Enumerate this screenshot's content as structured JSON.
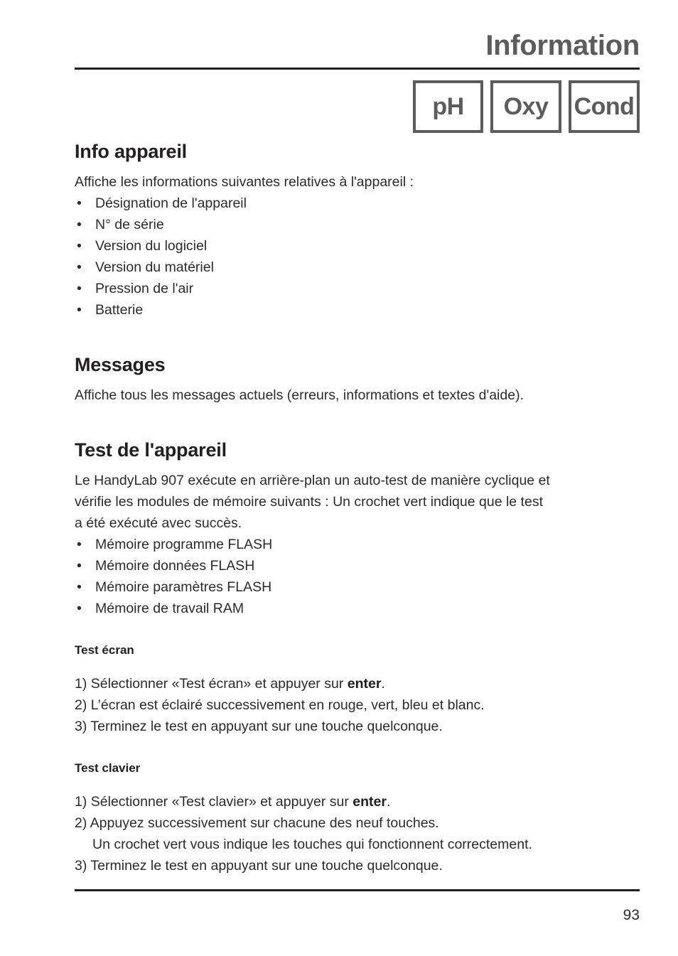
{
  "header": {
    "title": "Information",
    "mode_boxes": [
      {
        "label": "pH"
      },
      {
        "label": "Oxy"
      },
      {
        "label": "Cond"
      }
    ]
  },
  "sections": {
    "info_appareil": {
      "heading": "Info appareil",
      "intro": "Affiche les informations suivantes relatives à l'appareil :",
      "bullets": [
        "Désignation de l'appareil",
        "N° de série",
        "Version du logiciel",
        "Version du matériel",
        "Pression de l'air",
        "Batterie"
      ]
    },
    "messages": {
      "heading": "Messages",
      "intro": "Affiche tous les messages actuels (erreurs, informations et textes d'aide)."
    },
    "test_appareil": {
      "heading": "Test de l'appareil",
      "intro_line1": "Le HandyLab 907 exécute en arrière-plan un auto-test de manière cyclique et",
      "intro_line2": "vérifie les modules de mémoire suivants : Un crochet vert indique que le test",
      "intro_line3": "a été exécuté avec succès.",
      "bullets": [
        "Mémoire programme FLASH",
        "Mémoire données FLASH",
        "Mémoire paramètres FLASH",
        "Mémoire de travail RAM"
      ],
      "test_ecran": {
        "heading": "Test écran",
        "step1_prefix": "1) Sélectionner «Test écran» et appuyer sur ",
        "step1_key": "enter",
        "step1_suffix": ".",
        "step2": "2) L’écran est éclairé successivement en rouge, vert, bleu et blanc.",
        "step3": "3) Terminez le test en appuyant sur une touche quelconque."
      },
      "test_clavier": {
        "heading": "Test clavier",
        "step1_prefix": "1) Sélectionner «Test clavier» et appuyer sur ",
        "step1_key": "enter",
        "step1_suffix": ".",
        "step2": "2) Appuyez successivement sur chacune des neuf touches.",
        "step2_note": "Un crochet vert vous indique les touches qui fonctionnent correctement.",
        "step3": "3) Terminez le test en appuyant sur une touche quelconque."
      }
    }
  },
  "footer": {
    "page_number": "93"
  },
  "colors": {
    "rule": "#231f20",
    "header_gray": "#5c5c5c",
    "body_text": "#2b2b2b"
  }
}
